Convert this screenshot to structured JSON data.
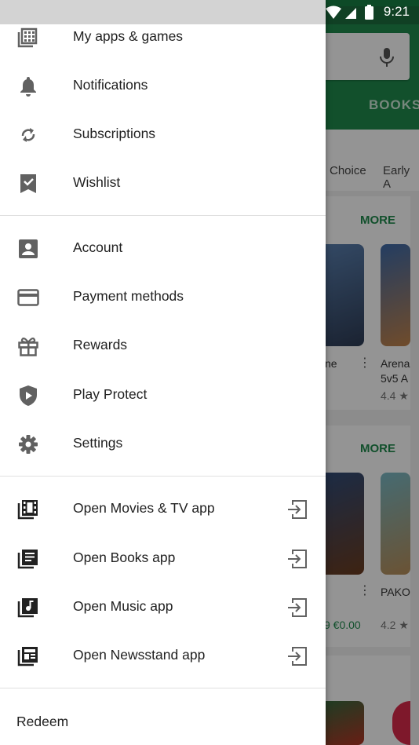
{
  "status_bar": {
    "time": "9:21"
  },
  "background": {
    "tab_books": "BOOKS",
    "chip_1": "Choice",
    "chip_2": "Early A",
    "more_1": "MORE",
    "more_2": "MORE",
    "card1_app1_title": "ne",
    "card1_app2_title_line1": "Arena",
    "card1_app2_title_line2": "5v5 A",
    "card1_app2_rating": "4.4 ★",
    "card2_app1_price": "9 €0.00",
    "card2_app2_title": "PAKO",
    "card2_app2_rating": "4.2 ★"
  },
  "drawer": {
    "items": [
      {
        "label": "My apps & games",
        "icon": "apps-grid-icon"
      },
      {
        "label": "Notifications",
        "icon": "bell-icon"
      },
      {
        "label": "Subscriptions",
        "icon": "refresh-icon"
      },
      {
        "label": "Wishlist",
        "icon": "bookmark-check-icon"
      },
      {
        "label": "Account",
        "icon": "account-box-icon"
      },
      {
        "label": "Payment methods",
        "icon": "credit-card-icon"
      },
      {
        "label": "Rewards",
        "icon": "gift-icon"
      },
      {
        "label": "Play Protect",
        "icon": "shield-play-icon"
      },
      {
        "label": "Settings",
        "icon": "gear-icon"
      },
      {
        "label": "Open Movies & TV app",
        "icon": "movies-icon"
      },
      {
        "label": "Open Books app",
        "icon": "books-icon"
      },
      {
        "label": "Open Music app",
        "icon": "music-icon"
      },
      {
        "label": "Open Newsstand app",
        "icon": "newsstand-icon"
      }
    ],
    "redeem": "Redeem"
  }
}
